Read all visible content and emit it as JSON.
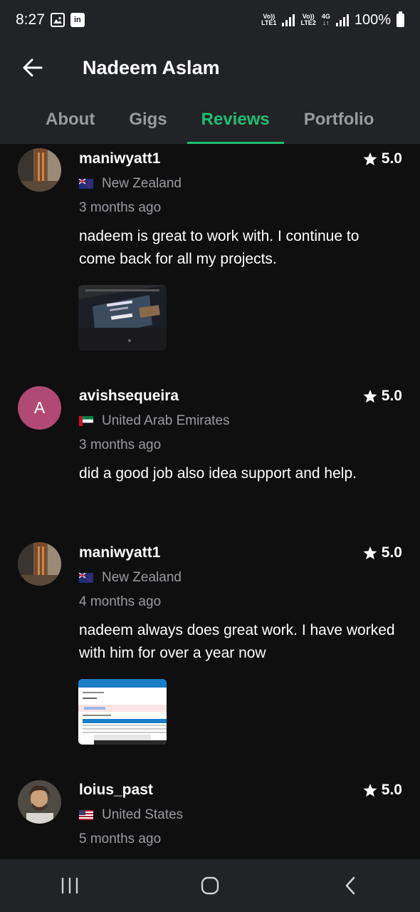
{
  "status_bar": {
    "time": "8:27",
    "notif_icons": [
      "image-icon",
      "linkedin-icon"
    ],
    "linkedin_text": "in",
    "sim1_top": "Vo))",
    "sim1_bottom": "LTE1",
    "sim2_top": "Vo))",
    "sim2_bottom": "LTE2",
    "net_top": "4G",
    "net_bottom": "↓↑",
    "battery": "100%"
  },
  "header": {
    "back_icon": "arrow-left-icon",
    "title": "Nadeem Aslam"
  },
  "tabs": [
    {
      "label": "About",
      "active": false
    },
    {
      "label": "Gigs",
      "active": false
    },
    {
      "label": "Reviews",
      "active": true
    },
    {
      "label": "Portfolio",
      "active": false
    }
  ],
  "colors": {
    "accent": "#1dbf73",
    "background": "#0f0f10",
    "bar": "#222326",
    "muted_text": "#9a9ba0",
    "avatar_letter_bg": "#b04a74"
  },
  "reviews": [
    {
      "username": "maniwyatt1",
      "rating": "5.0",
      "country": "New Zealand",
      "flag": "nz",
      "time": "3 months ago",
      "text": "nadeem is great to work with. I continue to come back for all my projects.",
      "has_attachment": true
    },
    {
      "username": "avishsequeira",
      "avatar_letter": "A",
      "rating": "5.0",
      "country": "United Arab Emirates",
      "flag": "ae",
      "time": "3 months ago",
      "text": "did a good job also idea support and help.",
      "has_attachment": false
    },
    {
      "username": "maniwyatt1",
      "rating": "5.0",
      "country": "New Zealand",
      "flag": "nz",
      "time": "4 months ago",
      "text": "nadeem always does great work. I have worked with him for over a year now",
      "has_attachment": true
    },
    {
      "username": "loius_past",
      "rating": "5.0",
      "country": "United States",
      "flag": "us",
      "time": "5 months ago",
      "text": "",
      "has_attachment": false
    }
  ],
  "nav_bar": {
    "buttons": [
      "recent-apps-icon",
      "home-icon",
      "back-icon"
    ]
  }
}
